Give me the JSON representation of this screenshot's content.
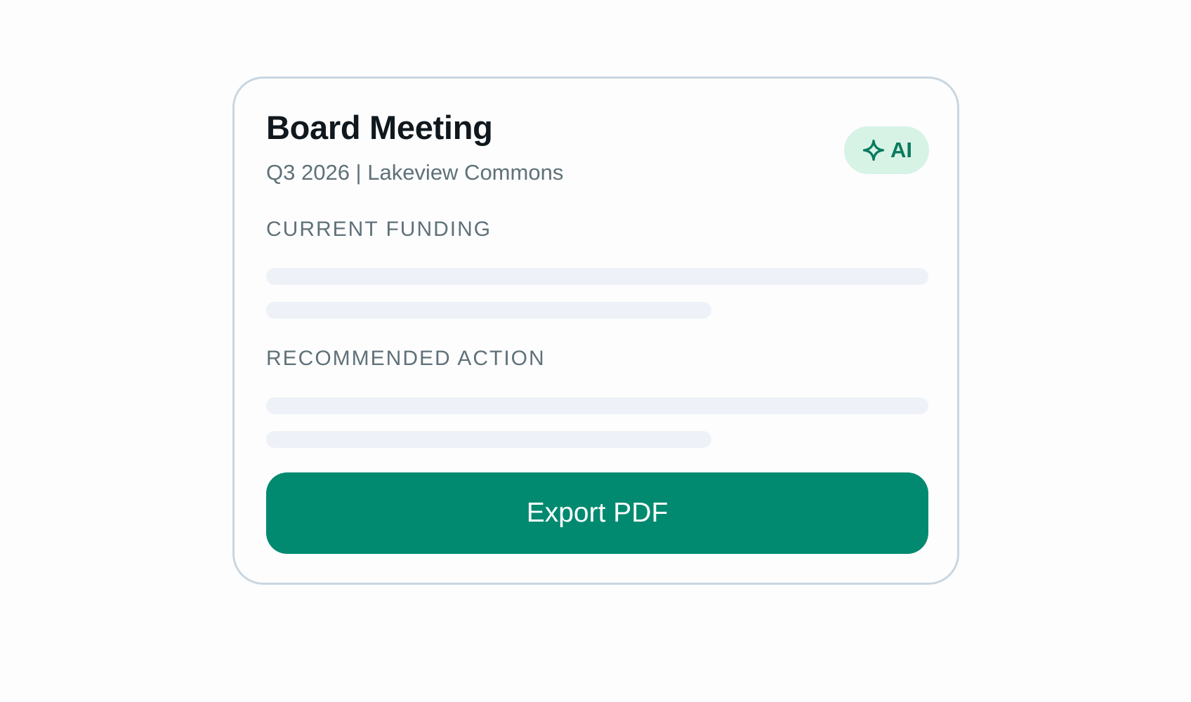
{
  "card": {
    "title": "Board Meeting",
    "subtitle": "Q3 2026 | Lakeview Commons",
    "ai_badge": {
      "label": "AI",
      "icon": "sparkle-icon"
    },
    "sections": [
      {
        "label": "CURRENT FUNDING"
      },
      {
        "label": "RECOMMENDED ACTION"
      }
    ],
    "export_button": {
      "label": "Export PDF"
    }
  },
  "colors": {
    "accent": "#028a70",
    "badge_bg": "#d7f3e5",
    "badge_fg": "#0a7a5f",
    "skeleton": "#eef1f7",
    "card_border": "#c9d6e0"
  }
}
